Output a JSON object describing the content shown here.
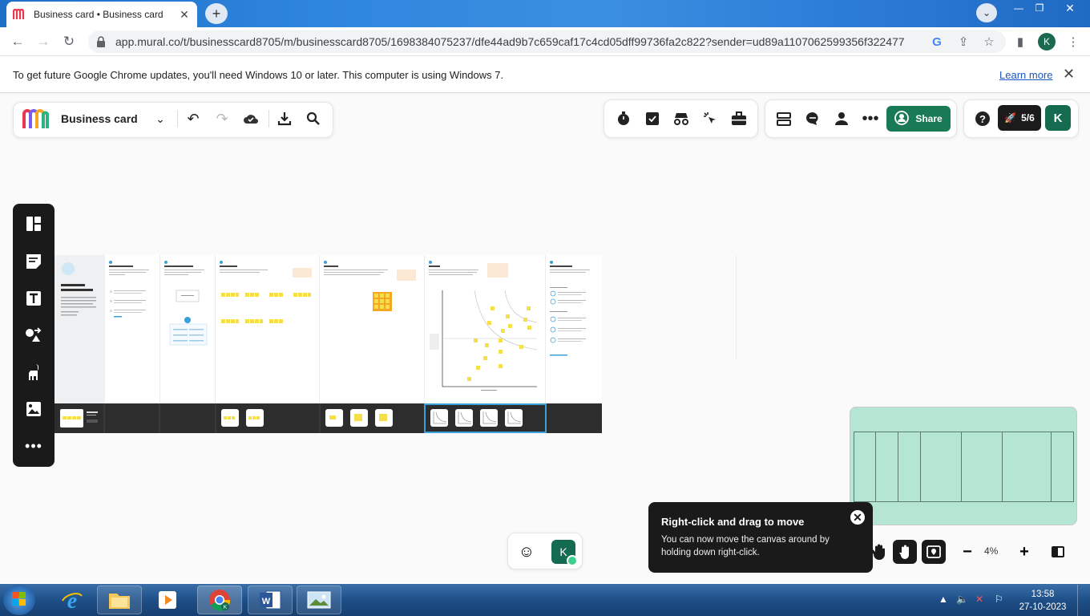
{
  "browser": {
    "tab_title": "Business card • Business card",
    "url": "app.mural.co/t/businesscard8705/m/businesscard8705/1698384075237/dfe44ad9b7c659caf17c4cd05dff99736fa2c822?sender=ud89a1107062599356f322477",
    "profile_initial": "K"
  },
  "infobar": {
    "message": "To get future Google Chrome updates, you'll need Windows 10 or later. This computer is using Windows 7.",
    "learn_more": "Learn more"
  },
  "mural": {
    "board_name": "Business card",
    "share_label": "Share",
    "onboarding_progress": "5/6",
    "user_initial": "K",
    "zoom": "4%",
    "brand_color": "#1a7a55"
  },
  "tooltip": {
    "title": "Right-click and drag to move",
    "body": "You can now move the canvas around by holding down right-click."
  },
  "taskbar": {
    "time": "13:58",
    "date": "27-10-2023"
  },
  "icons": [
    "mural-logo",
    "undo-icon",
    "redo-icon",
    "cloud-sync-icon",
    "download-icon",
    "search-icon",
    "timer-icon",
    "voting-icon",
    "private-mode-icon",
    "cursor-icon",
    "toolbox-icon",
    "outline-icon",
    "comment-icon",
    "user-icon",
    "more-icon",
    "help-icon",
    "rocket-icon",
    "emoji-icon",
    "hand-icon",
    "select-icon",
    "map-icon",
    "minus-icon",
    "plus-icon",
    "panel-icon"
  ]
}
